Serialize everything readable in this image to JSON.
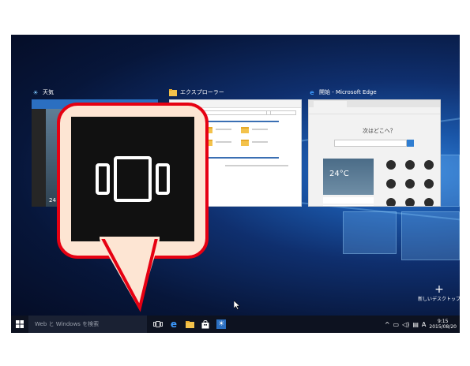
{
  "thumbnails": [
    {
      "title": "天気",
      "icon": "weather-sun-icon",
      "temp": "24"
    },
    {
      "title": "エクスプローラー",
      "icon": "folder-icon"
    },
    {
      "title": "開始 - Microsoft Edge",
      "icon": "edge-icon",
      "greeting": "次はどこへ？",
      "temp": "24°C"
    }
  ],
  "taskbar": {
    "search_placeholder": "Web と Windows を検索",
    "time": "9:15",
    "date": "2015/08/20",
    "ime": "A"
  },
  "new_desktop_label": "新しいデスクトップ",
  "callout": {
    "icon": "task-view-icon"
  },
  "colors": {
    "callout_border": "#e60012",
    "callout_fill": "#fde5d3",
    "accent": "#2f7dd1"
  }
}
